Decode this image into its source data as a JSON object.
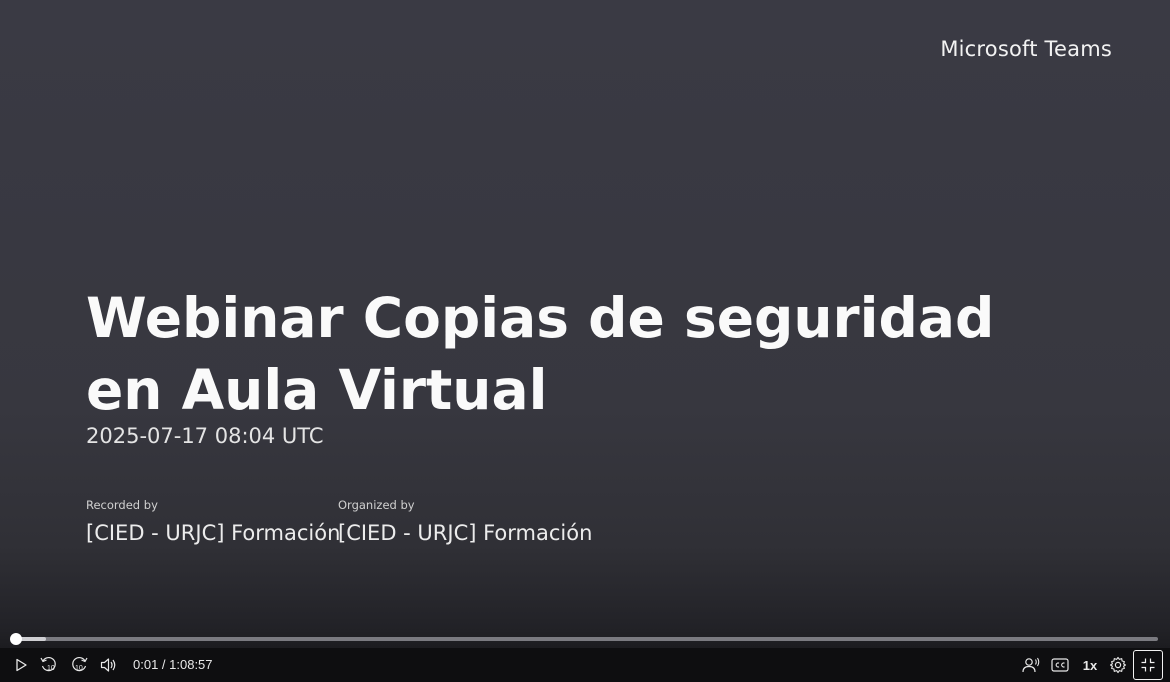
{
  "slide": {
    "brand": "Microsoft Teams",
    "title": "Webinar Copias de seguridad en Aula Virtual",
    "datetime": "2025-07-17 08:04 UTC",
    "recorded_by_label": "Recorded by",
    "recorded_by": "[CIED - URJC] Formación",
    "organized_by_label": "Organized by",
    "organized_by": "[CIED - URJC] Formación"
  },
  "player": {
    "time_display": "0:01 / 1:08:57",
    "progress_fraction": 0.0002,
    "buffered_fraction": 0.026,
    "skip_back_seconds": "10",
    "skip_forward_seconds": "10",
    "speed": "1x",
    "colors": {
      "track": "#7a7a80",
      "buffer": "#cfcfd3",
      "thumb": "#ffffff",
      "bar": "#0e0e10"
    },
    "icons": [
      "play-icon",
      "skip-back-10-icon",
      "skip-forward-10-icon",
      "volume-icon",
      "speakers-icon",
      "captions-icon",
      "settings-icon",
      "exit-fullscreen-icon"
    ]
  }
}
